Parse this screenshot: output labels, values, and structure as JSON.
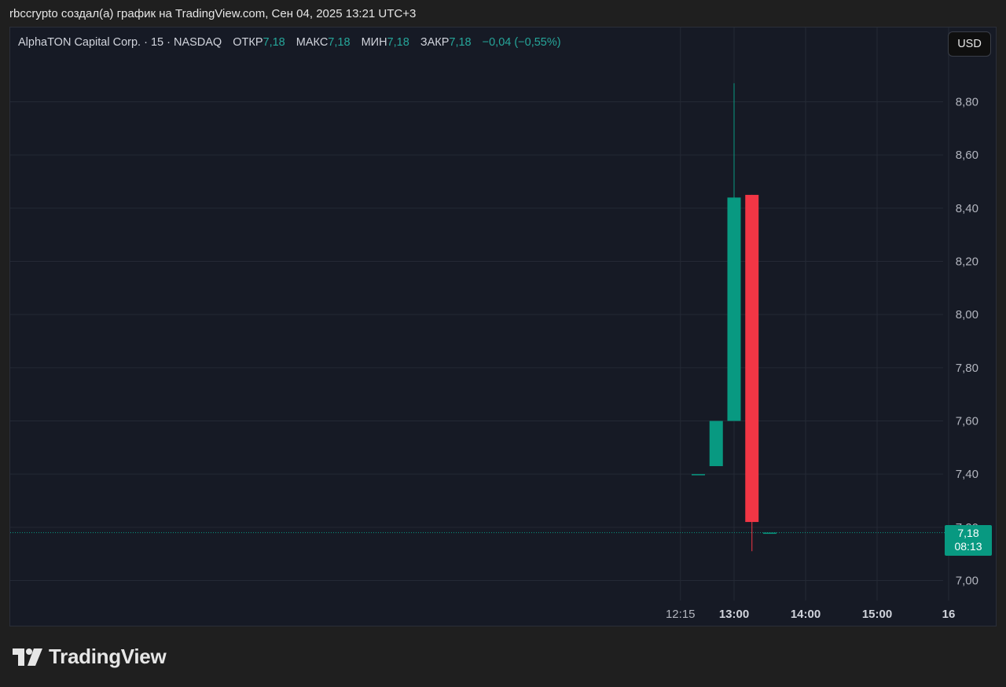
{
  "header": {
    "text": "rbccrypto создал(а) график на TradingView.com, Сен 04, 2025 13:21 UTC+3"
  },
  "legend": {
    "symbol": "AlphaTON Capital Corp. · 15 · NASDAQ",
    "open_label": "ОТКР",
    "open_value": "7,18",
    "high_label": "МАКС",
    "high_value": "7,18",
    "low_label": "МИН",
    "low_value": "7,18",
    "close_label": "ЗАКР",
    "close_value": "7,18",
    "change": "−0,04 (−0,55%)"
  },
  "currency_button": "USD",
  "price_tag": {
    "price": "7,18",
    "countdown": "08:13"
  },
  "footer": {
    "brand": "TradingView"
  },
  "colors": {
    "up": "#089981",
    "down": "#f23645",
    "background": "#161a25",
    "grid": "#242935",
    "axis_text": "#b2b5be"
  },
  "chart_data": {
    "type": "candlestick",
    "ylim": [
      6.95,
      8.95
    ],
    "y_ticks": [
      "7,00",
      "7,20",
      "7,40",
      "7,60",
      "7,80",
      "8,00",
      "8,20",
      "8,40",
      "8,60",
      "8,80"
    ],
    "y_tick_values": [
      7.0,
      7.2,
      7.4,
      7.6,
      7.8,
      8.0,
      8.2,
      8.4,
      8.6,
      8.8
    ],
    "x_ticks": [
      {
        "label": "12:15",
        "t": "12:15",
        "bold": false
      },
      {
        "label": "13:00",
        "t": "13:00",
        "bold": true
      },
      {
        "label": "14:00",
        "t": "14:00",
        "bold": true
      },
      {
        "label": "15:00",
        "t": "15:00",
        "bold": true
      },
      {
        "label": "16",
        "t": "16:00",
        "bold": true
      }
    ],
    "candles": [
      {
        "t": "12:30",
        "open": 7.4,
        "high": 7.4,
        "low": 7.4,
        "close": 7.4
      },
      {
        "t": "12:45",
        "open": 7.43,
        "high": 7.6,
        "low": 7.43,
        "close": 7.6
      },
      {
        "t": "13:00",
        "open": 7.6,
        "high": 8.87,
        "low": 7.6,
        "close": 8.44
      },
      {
        "t": "13:15",
        "open": 8.45,
        "high": 8.45,
        "low": 7.11,
        "close": 7.22
      },
      {
        "t": "13:30",
        "open": 7.18,
        "high": 7.18,
        "low": 7.18,
        "close": 7.18
      }
    ],
    "last_price": 7.18
  }
}
